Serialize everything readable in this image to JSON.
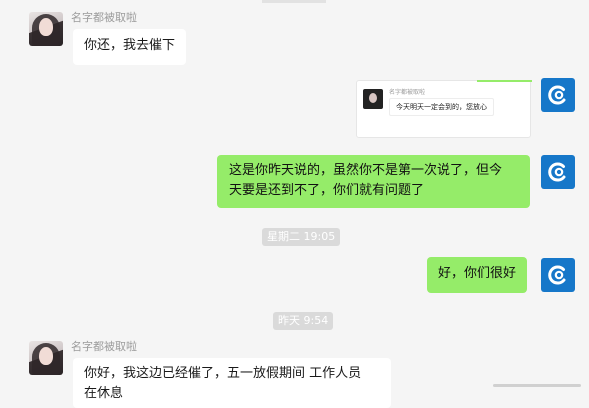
{
  "messages": [
    {
      "side": "left",
      "name": "名字都被取啦",
      "text": "你还，我去催下"
    },
    {
      "side": "right",
      "quote": {
        "name": "名字都被取啦",
        "text": "今天明天一定会到的，您放心"
      }
    },
    {
      "side": "right",
      "text_line1": "这是你昨天说的，虽然你不是第一次说了，但今",
      "text_line2": "天要是还到不了，你们就有问题了"
    },
    {
      "type": "time",
      "text": "星期二 19:05"
    },
    {
      "side": "right",
      "text": "好，你们很好"
    },
    {
      "type": "time",
      "text": "昨天 9:54"
    },
    {
      "side": "left",
      "name": "名字都被取啦",
      "text_line1": "你好，我这边已经催了，五一放假期间 工作人员",
      "text_line2": "在休息"
    }
  ],
  "colors": {
    "background": "#f5f5f5",
    "green_bubble": "#95ec69",
    "white_bubble": "#ffffff",
    "avatar_blue": "#1677c9"
  },
  "icons": {
    "self_avatar": "blue-c-logo-icon",
    "other_avatar": "girl-photo-avatar"
  }
}
